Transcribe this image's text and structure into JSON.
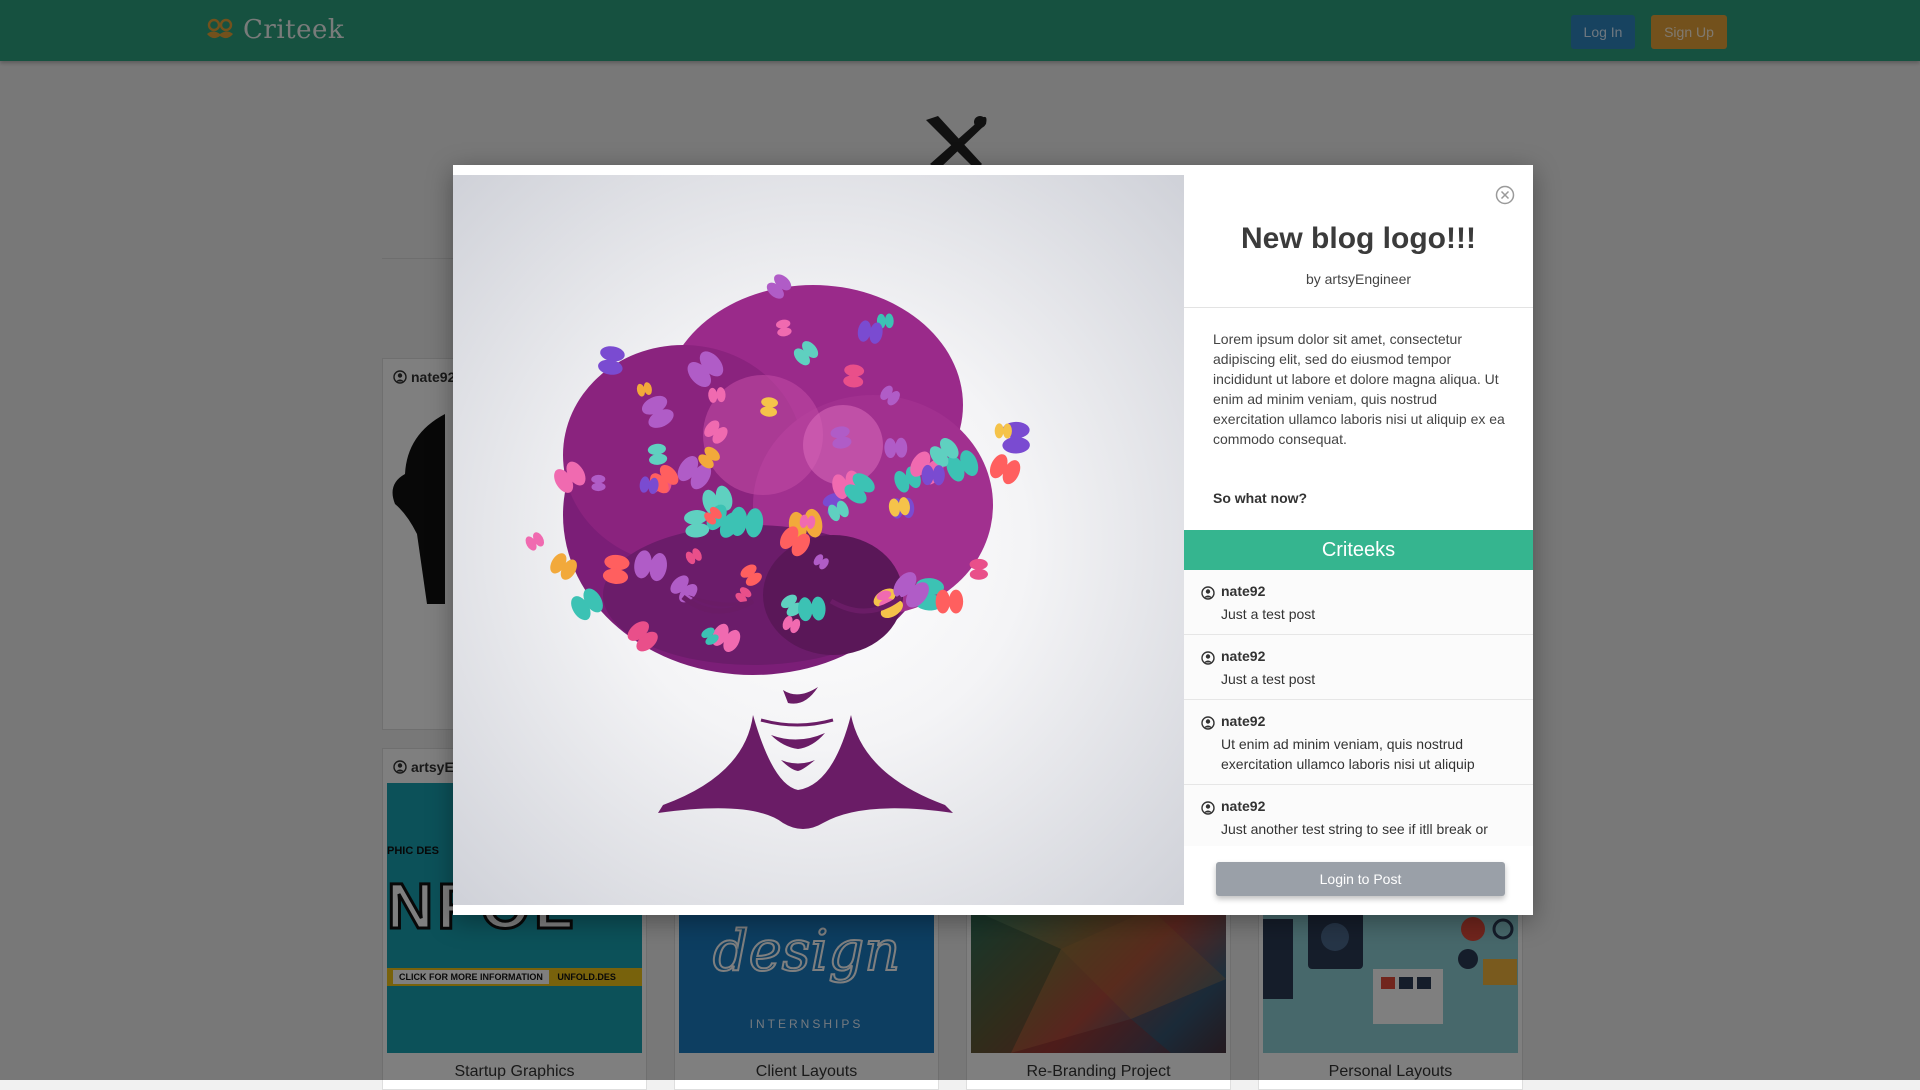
{
  "nav": {
    "brand": "Criteek",
    "login_label": "Log In",
    "signup_label": "Sign Up"
  },
  "background": {
    "cards": [
      {
        "user": "nate92",
        "title": ""
      },
      {
        "user": "artsyE",
        "title": "Startup Graphics"
      },
      {
        "user": "",
        "title": "Client Layouts"
      },
      {
        "user": "",
        "title": "Re-Branding Project"
      },
      {
        "user": "",
        "title": "Personal Layouts"
      }
    ],
    "thumb_texts": {
      "infold_top": "PHIC DES",
      "infold_big": "NFOL",
      "infold_banner": "CLICK FOR MORE INFORMATION",
      "infold_site": "UNFOLD.DES",
      "design_script": "design",
      "design_sub": "INTERNSHIPS"
    }
  },
  "modal": {
    "title": "New blog logo!!!",
    "author": "by artsyEngineer",
    "description": "Lorem ipsum dolor sit amet, consectetur adipiscing elit, sed do eiusmod tempor incididunt ut labore et dolore magna aliqua. Ut enim ad minim veniam, quis nostrud exercitation ullamco laboris nisi ut aliquip ex ea commodo consequat.",
    "question": "So what now?",
    "criteeks_header": "Criteeks",
    "comments": [
      {
        "user": "nate92",
        "text": "Just a test post"
      },
      {
        "user": "nate92",
        "text": "Just a test post"
      },
      {
        "user": "nate92",
        "text": "Ut enim ad minim veniam, quis nostrud exercitation ullamco laboris nisi ut aliquip"
      },
      {
        "user": "nate92",
        "text": "Just another test string to see if itll break or"
      }
    ],
    "login_to_post_label": "Login to Post"
  },
  "colors": {
    "navbar": "#2ca381",
    "login_button": "#2e86c1",
    "signup_button": "#e6a238",
    "criteeks_header": "#35b58f",
    "login_to_post": "#9aa0a8"
  },
  "icons": [
    "mustache-logo-icon",
    "pen-brush-cross-icon",
    "user-circle-icon",
    "close-circle-icon"
  ]
}
